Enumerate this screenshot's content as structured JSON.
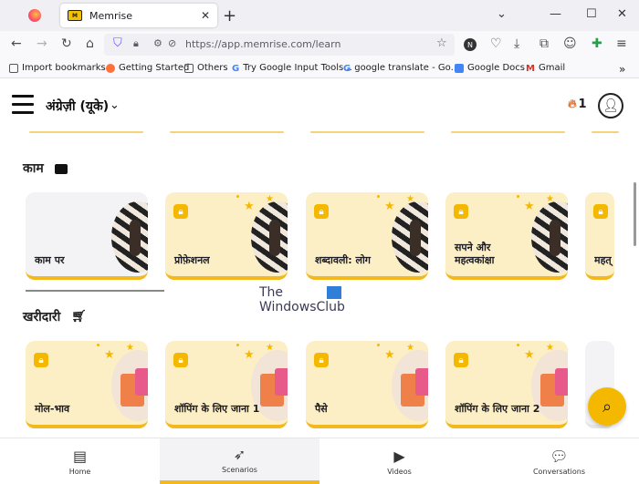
{
  "browser": {
    "tab_title": "Memrise",
    "url": "https://app.memrise.com/learn",
    "bookmarks": [
      "Import bookmarks...",
      "Getting Started",
      "Others",
      "Try Google Input Tools...",
      "google translate - Go...",
      "Google Docs",
      "Gmail"
    ]
  },
  "header": {
    "language": "अंग्रेज़ी (यूके)",
    "streak": "1"
  },
  "sections": [
    {
      "title": "काम",
      "icon": "briefcase-icon",
      "cards": [
        {
          "label": "काम पर",
          "locked": false
        },
        {
          "label": "प्रोफ़ेशनल",
          "locked": true
        },
        {
          "label": "शब्दावली: लोग",
          "locked": true
        },
        {
          "label": "सपने और महत्वकांक्षा",
          "locked": true
        },
        {
          "label": "महत्",
          "locked": true
        }
      ]
    },
    {
      "title": "खरीदारी",
      "icon": "cart-icon",
      "cards": [
        {
          "label": "मोल-भाव",
          "locked": true
        },
        {
          "label": "शॉपिंग के लिए जाना 1",
          "locked": true
        },
        {
          "label": "पैसे",
          "locked": true
        },
        {
          "label": "शॉपिंग के लिए जाना 2",
          "locked": true
        }
      ]
    }
  ],
  "watermark": {
    "line1": "The",
    "line2": "WindowsClub"
  },
  "bottom_nav": [
    {
      "label": "Home",
      "icon": "home-icon",
      "active": false
    },
    {
      "label": "Scenarios",
      "icon": "scenarios-icon",
      "active": true
    },
    {
      "label": "Videos",
      "icon": "videos-icon",
      "active": false
    },
    {
      "label": "Conversations",
      "icon": "chat-icon",
      "active": false
    }
  ]
}
